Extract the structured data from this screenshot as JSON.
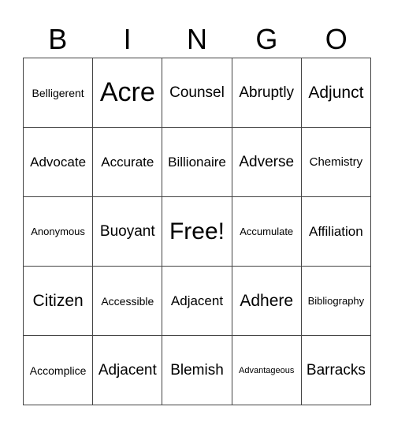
{
  "header": [
    "B",
    "I",
    "N",
    "G",
    "O"
  ],
  "rows": [
    [
      "Belligerent",
      "Acre",
      "Counsel",
      "Abruptly",
      "Adjunct"
    ],
    [
      "Advocate",
      "Accurate",
      "Billionaire",
      "Adverse",
      "Chemistry"
    ],
    [
      "Anonymous",
      "Buoyant",
      "Free!",
      "Accumulate",
      "Affiliation"
    ],
    [
      "Citizen",
      "Accessible",
      "Adjacent",
      "Adhere",
      "Bibliography"
    ],
    [
      "Accomplice",
      "Adjacent",
      "Blemish",
      "Advantageous",
      "Barracks"
    ]
  ]
}
